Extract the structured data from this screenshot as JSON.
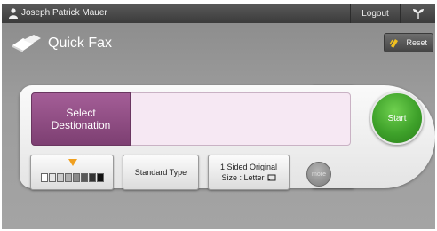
{
  "topbar": {
    "user_name": "Joseph Patrick Mauer",
    "logout_label": "Logout",
    "user_icon": "user-icon",
    "eco_icon": "leaf-sprout-icon"
  },
  "header": {
    "title": "Quick Fax",
    "title_icon": "fax-icon",
    "reset_label": "Reset",
    "reset_icon": "eraser-icon"
  },
  "destination": {
    "select_label_line1": "Select",
    "select_label_line2": "Destionation",
    "value": ""
  },
  "start": {
    "label": "Start"
  },
  "options": {
    "density_icon": "density-scale-icon",
    "type_label": "Standard Type",
    "original_line1": "1 Sided Original",
    "original_line2": "Size : Letter",
    "original_icon": "orientation-icon",
    "more_label": "more"
  },
  "colors": {
    "accent_purple": "#8e4b82",
    "start_green": "#3ea12a",
    "density_marker": "#f0a020"
  }
}
